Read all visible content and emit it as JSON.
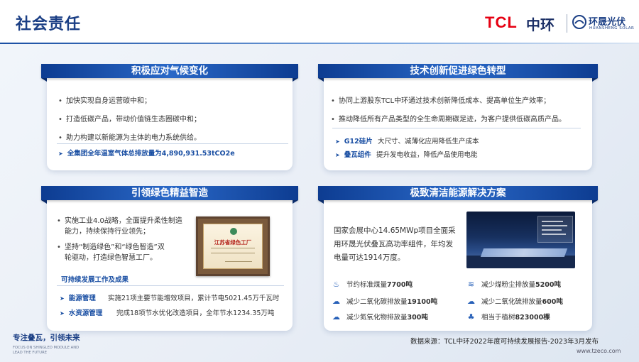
{
  "header": {
    "title": "社会责任",
    "logo_tcl": "TCL",
    "logo_zhonghuan": "中环",
    "logo_hs_cn": "环晟光伏",
    "logo_hs_en": "HUANSHENG SOLAR"
  },
  "climate": {
    "title": "积极应对气候变化",
    "bullets": [
      "加快实现自身运营碳中和；",
      "打造低碳产品，带动价值链生态圈碳中和；",
      "助力构建以新能源为主体的电力系统供给。"
    ],
    "highlight": "全集团全年温室气体总排放量为4,890,931.53tCO2e"
  },
  "innovation": {
    "title": "技术创新促进绿色转型",
    "bullets": [
      "协同上游股东TCL中环通过技术创新降低成本、提高单位生产效率；",
      "推动降低所有产品类型的全生命周期碳足迹，为客户提供低碳高质产品。"
    ],
    "items": [
      {
        "label": "G12硅片",
        "text": "大尺寸、减薄化应用降低生产成本"
      },
      {
        "label": "叠瓦组件",
        "text": "提升发电收益，降低产品使用电能"
      }
    ]
  },
  "manufacturing": {
    "title": "引领绿色精益智造",
    "bullets": [
      {
        "l1": "实施工业4.0战略，全面提升柔性制造",
        "l2": "能力，持续保持行业领先；"
      },
      {
        "l1": "坚持“制造绿色”和“绿色智造”双",
        "l2": "轮驱动，打造绿色智慧工厂。"
      }
    ],
    "certificate_title": "江苏省绿色工厂",
    "sub_title": "可持续发展工作及成果",
    "rows": [
      {
        "label": "能源管理",
        "text": "实施21项主要节能增效项目，累计节电5021.45万千瓦时"
      },
      {
        "label": "水资源管理",
        "text": "完成18项节水优化改造项目，全年节水1234.35万吨"
      }
    ]
  },
  "clean_energy": {
    "title": "极致清洁能源解决方案",
    "desc_lines": [
      "国家会展中心14.65MWp项目全面采",
      "用环晟光伏叠瓦高功率组件，年均发",
      "电量可达1914万度。"
    ],
    "stats": [
      {
        "icon": "coal-icon",
        "glyph": "♨",
        "pre": "节约标准煤量",
        "val": "7700吨"
      },
      {
        "icon": "dust-icon",
        "glyph": "≋",
        "pre": "减少煤粉尘排放量",
        "val": "5200吨"
      },
      {
        "icon": "co2-icon",
        "glyph": "☁",
        "pre": "减少二氧化碳排放量",
        "val": "19100吨"
      },
      {
        "icon": "so2-icon",
        "glyph": "☁",
        "pre": "减少二氧化硫排放量",
        "val": "600吨"
      },
      {
        "icon": "nox-icon",
        "glyph": "☁",
        "pre": "减少氮氧化物排放量",
        "val": "300吨"
      },
      {
        "icon": "tree-icon",
        "glyph": "♣",
        "pre": "相当于植树",
        "val": "823000棵"
      }
    ]
  },
  "footer": {
    "slogan_cn": "专注叠瓦，引领未来",
    "slogan_en": "FOCUS ON SHINGLED MODULE AND LEAD THE FUTURE",
    "source": "数据来源：TCL中环2022年度可持续发展报告-2023年3月发布",
    "url": "www.tzeco.com"
  }
}
